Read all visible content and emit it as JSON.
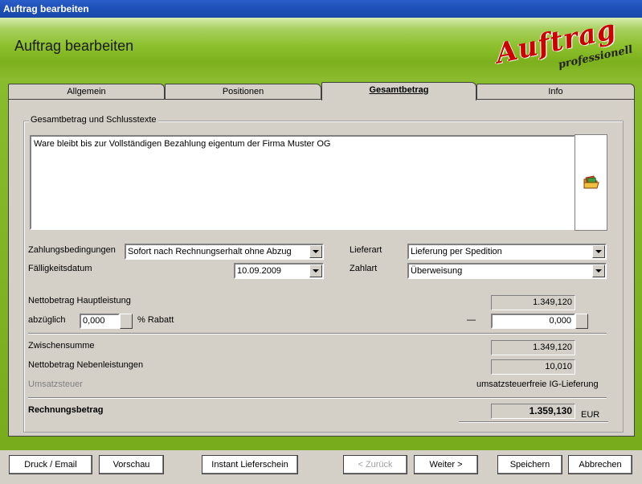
{
  "window": {
    "title": "Auftrag bearbeiten"
  },
  "header": {
    "title": "Auftrag bearbeiten",
    "logo_main": "Auftrag",
    "logo_sub": "professionell"
  },
  "tabs": [
    {
      "label": "Allgemein",
      "active": false
    },
    {
      "label": "Positionen",
      "active": false
    },
    {
      "label": "Gesamtbetrag",
      "active": true
    },
    {
      "label": "Info",
      "active": false
    }
  ],
  "group": {
    "legend": "Gesamtbetrag und Schlusstexte",
    "text": "Ware bleibt bis zur Vollständigen Bezahlung eigentum der Firma Muster OG",
    "open_button_icon": "folder-icon"
  },
  "form": {
    "zahlungsbedingungen_label": "Zahlungsbedingungen",
    "zahlungsbedingungen_value": "Sofort nach Rechnungserhalt ohne Abzug",
    "faelligkeitsdatum_label": "Fälligkeitsdatum",
    "faelligkeitsdatum_value": "10.09.2009",
    "lieferart_label": "Lieferart",
    "lieferart_value": "Lieferung per Spedition",
    "zahlart_label": "Zahlart",
    "zahlart_value": "Überweisung"
  },
  "totals": {
    "netto_haupt_label": "Nettobetrag Hauptleistung",
    "netto_haupt_value": "1.349,120",
    "abzueglich_label": "abzüglich",
    "rabatt_percent": "0,000",
    "rabatt_label": "% Rabatt",
    "minus_sign": "—",
    "rabatt_amount": "0,000",
    "zwischensumme_label": "Zwischensumme",
    "zwischensumme_value": "1.349,120",
    "netto_neben_label": "Nettobetrag Nebenleistungen",
    "netto_neben_value": "10,010",
    "ust_label": "Umsatzsteuer",
    "ust_value": "umsatzsteuerfreie IG-Lieferung",
    "rechnungsbetrag_label": "Rechnungsbetrag",
    "rechnungsbetrag_value": "1.359,130",
    "currency": "EUR"
  },
  "buttons": {
    "druck": "Druck / Email",
    "vorschau": "Vorschau",
    "lieferschein": "Instant Lieferschein",
    "zurueck": "< Zurück",
    "weiter": "Weiter >",
    "speichern": "Speichern",
    "abbrechen": "Abbrechen"
  },
  "colors": {
    "titlebar": "#1e4fb8",
    "header_green": "#8cc02c",
    "logo_red": "#cc0000",
    "panel": "#d4d0c8"
  }
}
